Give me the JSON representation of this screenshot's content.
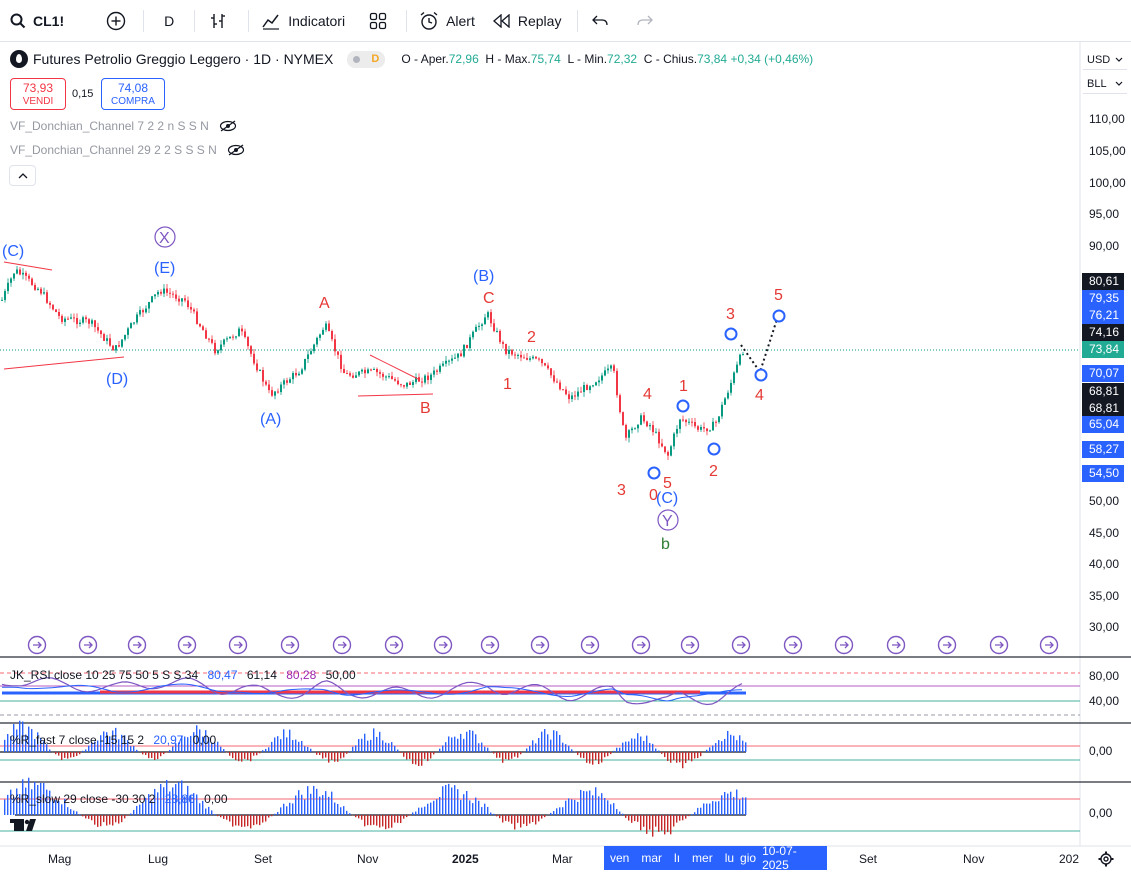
{
  "toolbar": {
    "symbol": "CL1!",
    "interval": "D",
    "indicators_label": "Indicatori",
    "alert_label": "Alert",
    "replay_label": "Replay"
  },
  "legend": {
    "title": "Futures Petrolio Greggio Leggero · 1D · NYMEX",
    "badge": "D",
    "open_label": "O - Aper.",
    "open": "72,96",
    "high_label": "H - Max.",
    "high": "75,74",
    "low_label": "L - Min.",
    "low": "72,32",
    "close_label": "C - Chius.",
    "close": "73,84",
    "change": "+0,34 (+0,46%)"
  },
  "trade": {
    "sell_price": "73,93",
    "sell_label": "VENDI",
    "spread": "0,15",
    "buy_price": "74,08",
    "buy_label": "COMPRA"
  },
  "indicators": {
    "donchian_7": "VF_Donchian_Channel 7 2 2 n S S N",
    "donchian_29": "VF_Donchian_Channel 29 2 2 S S S N"
  },
  "panes": {
    "rsi": {
      "name": "JK_RSI close 10 25 75 50 5 S S 34",
      "v1": "80,47",
      "v2": "61,14",
      "v3": "80,28",
      "v4": "50,00",
      "tick_high": "80,00",
      "tick_low": "40,00"
    },
    "r_fast": {
      "name": "%R_fast 7 close -15 15 2",
      "v1": "20,97",
      "v2": "0,00",
      "tick": "0,00"
    },
    "r_slow": {
      "name": "%R_slow 29 close -30 30 2",
      "v1": "28,86",
      "v2": "0,00",
      "tick": "0,00"
    }
  },
  "scale": {
    "currency": "USD",
    "unit": "BLL",
    "ticks": [
      "110,00",
      "105,00",
      "100,00",
      "95,00",
      "90,00",
      "50,00",
      "45,00",
      "40,00",
      "35,00",
      "30,00"
    ],
    "tags": [
      {
        "value": "80,61",
        "color": "#131722"
      },
      {
        "value": "79,35",
        "color": "#2962ff"
      },
      {
        "value": "76,21",
        "color": "#2962ff"
      },
      {
        "value": "74,16",
        "color": "#131722"
      },
      {
        "value": "73,84",
        "color": "#22ab94"
      },
      {
        "value": "70,07",
        "color": "#2962ff"
      },
      {
        "value": "68,81",
        "color": "#131722"
      },
      {
        "value": "68,81",
        "color": "#131722"
      },
      {
        "value": "65,04",
        "color": "#2962ff"
      },
      {
        "value": "58,27",
        "color": "#2962ff"
      },
      {
        "value": "54,50",
        "color": "#2962ff"
      }
    ]
  },
  "time_axis": {
    "labels": [
      "Mag",
      "Lug",
      "Set",
      "Nov",
      "2025",
      "Mar",
      "Set",
      "Nov",
      "202"
    ],
    "highlight": [
      "ven",
      "mar",
      "lı",
      "mer",
      "lu",
      "gio",
      "10-07-2025"
    ]
  },
  "waves": {
    "blue": [
      "(C)",
      "(E)",
      "(D)",
      "(A)",
      "(B)",
      "(C)"
    ],
    "circled": [
      "X",
      "Y"
    ],
    "red": [
      "A",
      "B",
      "C",
      "2",
      "1",
      "4",
      "3",
      "0",
      "5",
      "1",
      "2",
      "3",
      "4",
      "5"
    ],
    "green": [
      "b"
    ]
  },
  "colors": {
    "up": "#089981",
    "down": "#f23645",
    "wave_blue": "#2962ff",
    "wave_red": "#e53935",
    "wave_green": "#2e7d32",
    "circle_purple": "#7e57c2",
    "accent": "#2962ff"
  }
}
